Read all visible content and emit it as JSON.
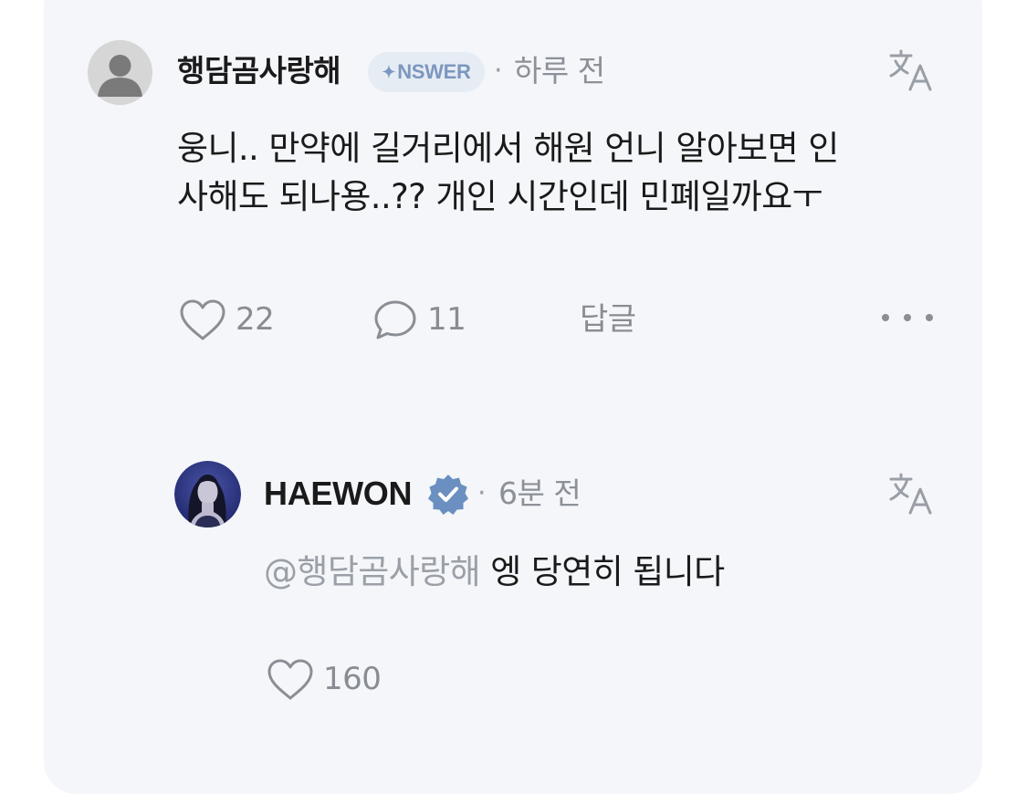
{
  "comment": {
    "username": "행담곰사랑해",
    "badge": "NSWER",
    "separator": "·",
    "time": "하루 전",
    "text_line1": "웅니.. 만약에 길거리에서 해원 언니 알아보면 인",
    "text_line2": "사해도 되나용..?? 개인 시간인데 민폐일까요ㅜ",
    "like_count": "22",
    "comment_count": "11",
    "reply_label": "답글"
  },
  "reply": {
    "username": "HAEWON",
    "separator": "·",
    "time": "6분 전",
    "mention": "@행담곰사랑해",
    "text": " 엥 당연히 됩니다",
    "like_count": "160"
  },
  "colors": {
    "card_bg": "#f4f6f9",
    "badge_bg": "#e6ecf4",
    "badge_text": "#7c97bf",
    "verified": "#6a8fc0",
    "muted": "#8c9098"
  }
}
